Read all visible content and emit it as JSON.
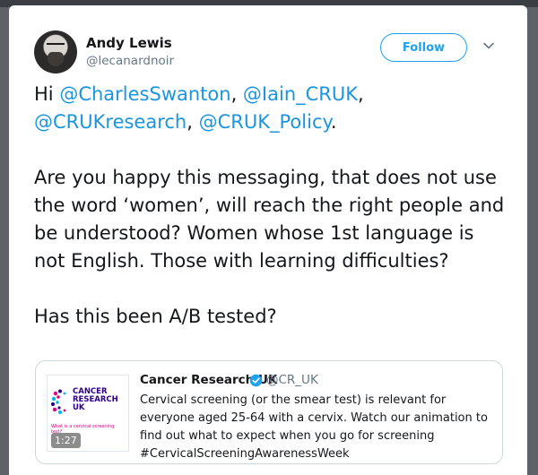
{
  "user": {
    "name": "Andy Lewis",
    "handle": "@lecanardnoir"
  },
  "actions": {
    "follow_label": "Follow"
  },
  "tweet": {
    "greeting": "Hi ",
    "mentions": [
      "@CharlesSwanton",
      "@Iain_CRUK",
      "@CRUKresearch",
      "@CRUK_Policy"
    ],
    "sep1": ", ",
    "sep2": ",",
    "sep3": ", ",
    "end_punct": ".",
    "paragraph2": "Are you happy this messaging, that does not use the word ‘women’, will reach the right people and be understood? Women whose 1st language is not English. Those with learning difficulties?",
    "paragraph3": "Has this been A/B tested?"
  },
  "quoted_tweet": {
    "name": "Cancer Research UK",
    "handle": "@CR_UK",
    "text": "Cervical screening (or the smear test) is relevant for everyone aged 25-64 with a cervix. Watch our animation to find out what to expect when you go for screening #CervicalScreeningAwarenessWeek",
    "thumbnail": {
      "logo_lines": [
        "CANCER",
        "RESEARCH",
        "UK"
      ],
      "caption": "What is a cervical screening test?",
      "duration": "1:27"
    }
  },
  "colors": {
    "accent": "#1da1f2",
    "mention": "#1b95e0",
    "text": "#14171a",
    "secondary": "#657786"
  },
  "icons": [
    "chevron-down-icon",
    "verified-badge-icon",
    "cancer-research-logo"
  ]
}
